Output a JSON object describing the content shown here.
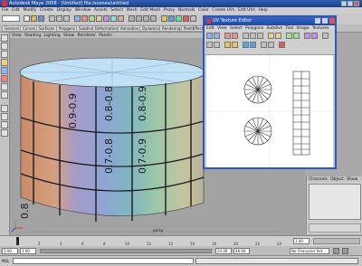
{
  "window": {
    "title": "Autodesk Maya 2008 - [Untitled] file:/scenes/untitled"
  },
  "main_menu": [
    "File",
    "Edit",
    "Modify",
    "Create",
    "Display",
    "Window",
    "Assets",
    "Select",
    "Mesh",
    "Edit Mesh",
    "Proxy",
    "Normals",
    "Color",
    "Create UVs",
    "Edit UVs",
    "Help"
  ],
  "shelf_tabs": [
    "General",
    "Curves",
    "Surfaces",
    "Polygons",
    "Subdivs",
    "Deformation",
    "Animation",
    "Dynamics",
    "Rendering",
    "PaintEffects",
    "Toon",
    "Muscle",
    "Fluids",
    "Fur",
    "Hair",
    "nCloth",
    "Custom"
  ],
  "viewport": {
    "menu": [
      "View",
      "Shading",
      "Lighting",
      "Show",
      "Renderer",
      "Panels"
    ],
    "label": "persp",
    "checker_labels": [
      "0.8-0.8",
      "0.8-0.9",
      "0.7-0.8",
      "0.7-0.9",
      "0.9-0.9",
      "0.8"
    ]
  },
  "uv_editor": {
    "title": "UV Texture Editor",
    "menu": [
      "Edit",
      "View",
      "Select",
      "Polygons",
      "Subdivs",
      "Tool",
      "Image",
      "Textures",
      "UV Sets",
      "Help"
    ]
  },
  "channel_box": {
    "menu": [
      "Channels",
      "Object",
      "Show"
    ]
  },
  "timeline": {
    "ticks": [
      "1",
      "2",
      "4",
      "6",
      "8",
      "10",
      "12",
      "14",
      "16",
      "18",
      "20",
      "22",
      "24"
    ],
    "current": "1.00"
  },
  "range": {
    "start": "1.00",
    "end": "24.00",
    "min": "1.00",
    "max": "48.00",
    "no_character_set": "No Character Set"
  },
  "command": {
    "mel_label": "MEL"
  },
  "colors": {
    "accent": "#2c58c6",
    "viewport_bg": "#a3a3a3"
  }
}
